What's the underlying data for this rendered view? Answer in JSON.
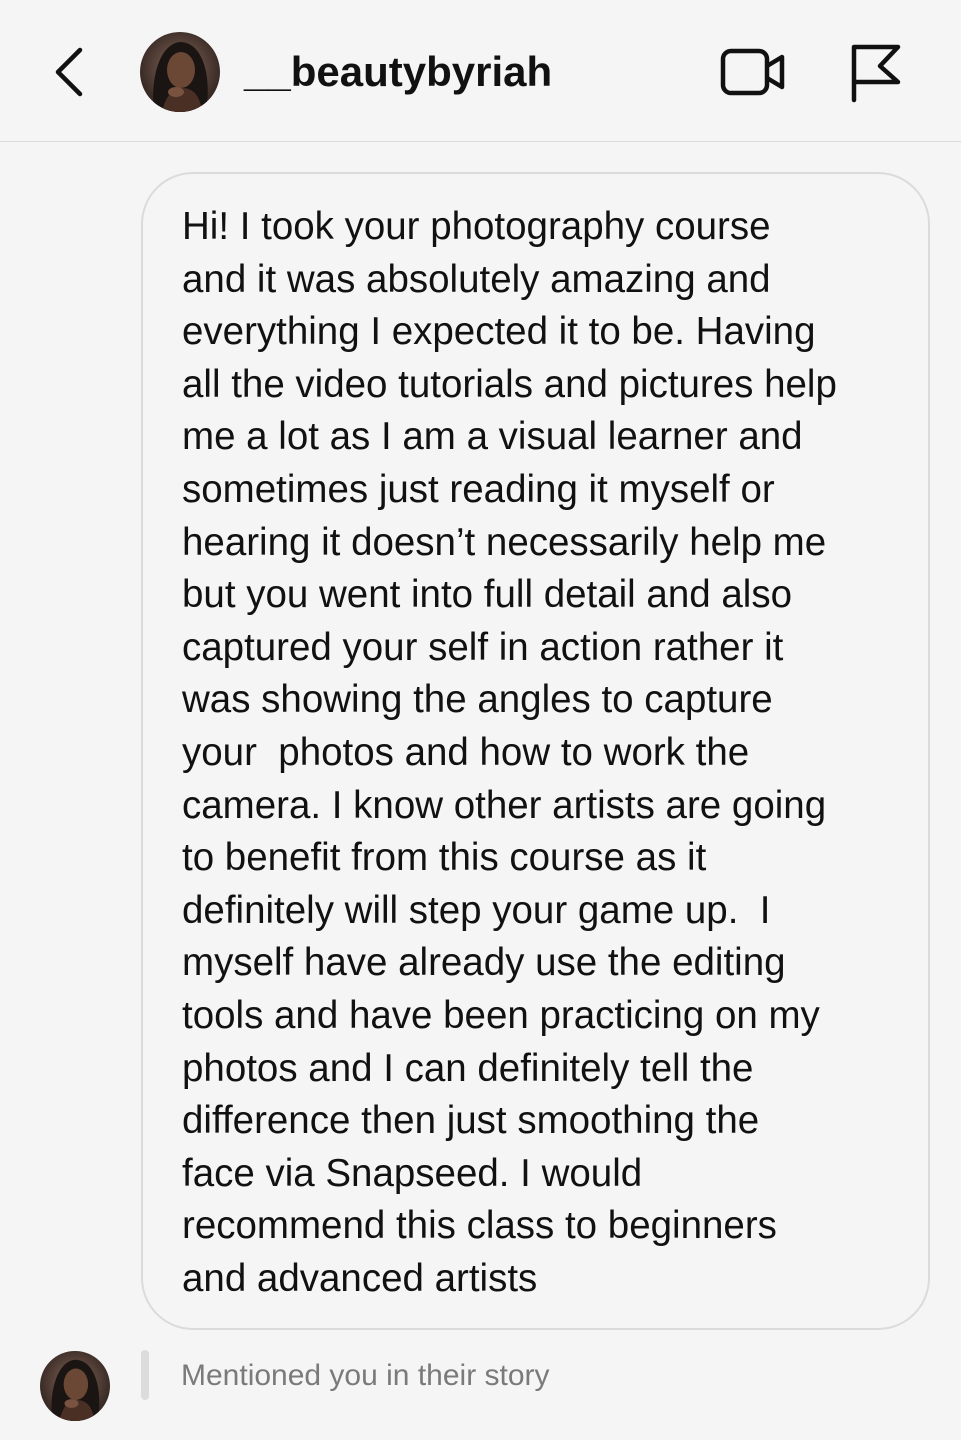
{
  "header": {
    "back_icon": "chevron-left-icon",
    "username": "__beautybyriah",
    "video_icon": "video-camera-icon",
    "flag_icon": "flag-icon"
  },
  "message": {
    "lines": [
      "Hi! I took your photography course",
      "and it was absolutely amazing and",
      "everything I expected it to be. Having",
      "all the video tutorials and pictures help",
      "me a lot as I am a visual learner and",
      "sometimes just reading it myself or",
      "hearing it doesn’t necessarily help me",
      "but you went into full detail and also",
      "captured your self in action rather it",
      "was showing the angles to capture",
      "your  photos and how to work the",
      "camera. I know other artists are going",
      "to benefit from this course as it",
      "definitely will step your game up.  I",
      "myself have already use the editing",
      "tools and have been practicing on my",
      "photos and I can definitely tell the",
      "difference then just smoothing the",
      "face via Snapseed. I would",
      "recommend this class to beginners",
      "and advanced artists"
    ]
  },
  "story_reply": {
    "text": "Mentioned you in their story"
  },
  "colors": {
    "background": "#f5f5f5",
    "text": "#111111",
    "muted_text": "#7a7a7a",
    "border": "#dbdbdb"
  }
}
